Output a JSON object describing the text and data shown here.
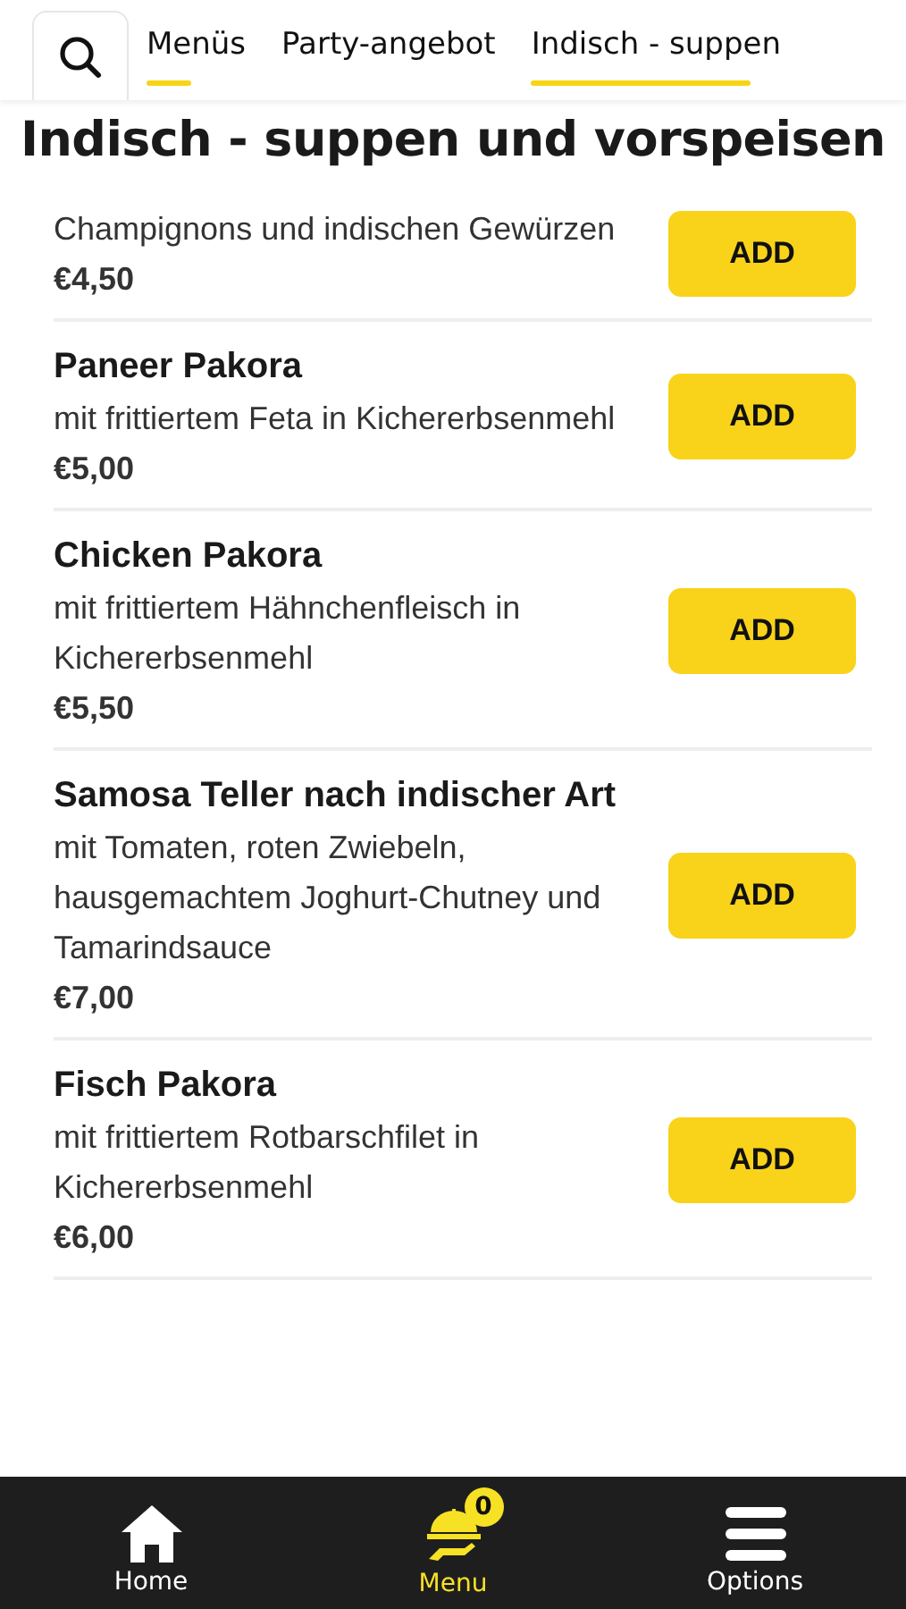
{
  "tabs": [
    {
      "label": "Menüs",
      "selected": true
    },
    {
      "label": "Party-angebot",
      "selected": false
    },
    {
      "label": "Indisch - suppen",
      "selected": true
    }
  ],
  "section_title": "Indisch - suppen und vorspeisen",
  "items": [
    {
      "description": "Champignons und indischen Gewürzen",
      "price": "€4,50",
      "button": "ADD"
    },
    {
      "name": "Paneer Pakora",
      "description": "mit frittiertem Feta in Kichererbsenmehl",
      "price": "€5,00",
      "button": "ADD"
    },
    {
      "name": "Chicken Pakora",
      "description": "mit frittiertem Hähnchenfleisch in Kichererbsenmehl",
      "price": "€5,50",
      "button": "ADD"
    },
    {
      "name": "Samosa Teller nach indischer Art",
      "description": "mit Tomaten, roten Zwiebeln, hausgemachtem Joghurt-Chutney und Tamarindsauce",
      "price": "€7,00",
      "button": "ADD"
    },
    {
      "name": "Fisch Pakora",
      "description": "mit frittiertem Rotbarschfilet in Kichererbsenmehl",
      "price": "€6,00",
      "button": "ADD"
    }
  ],
  "nav": [
    {
      "kind": "home",
      "label": "Home",
      "selected": false
    },
    {
      "kind": "menu",
      "label": "Menu",
      "selected": true,
      "badge": "0"
    },
    {
      "kind": "options",
      "label": "Options",
      "selected": false
    }
  ]
}
